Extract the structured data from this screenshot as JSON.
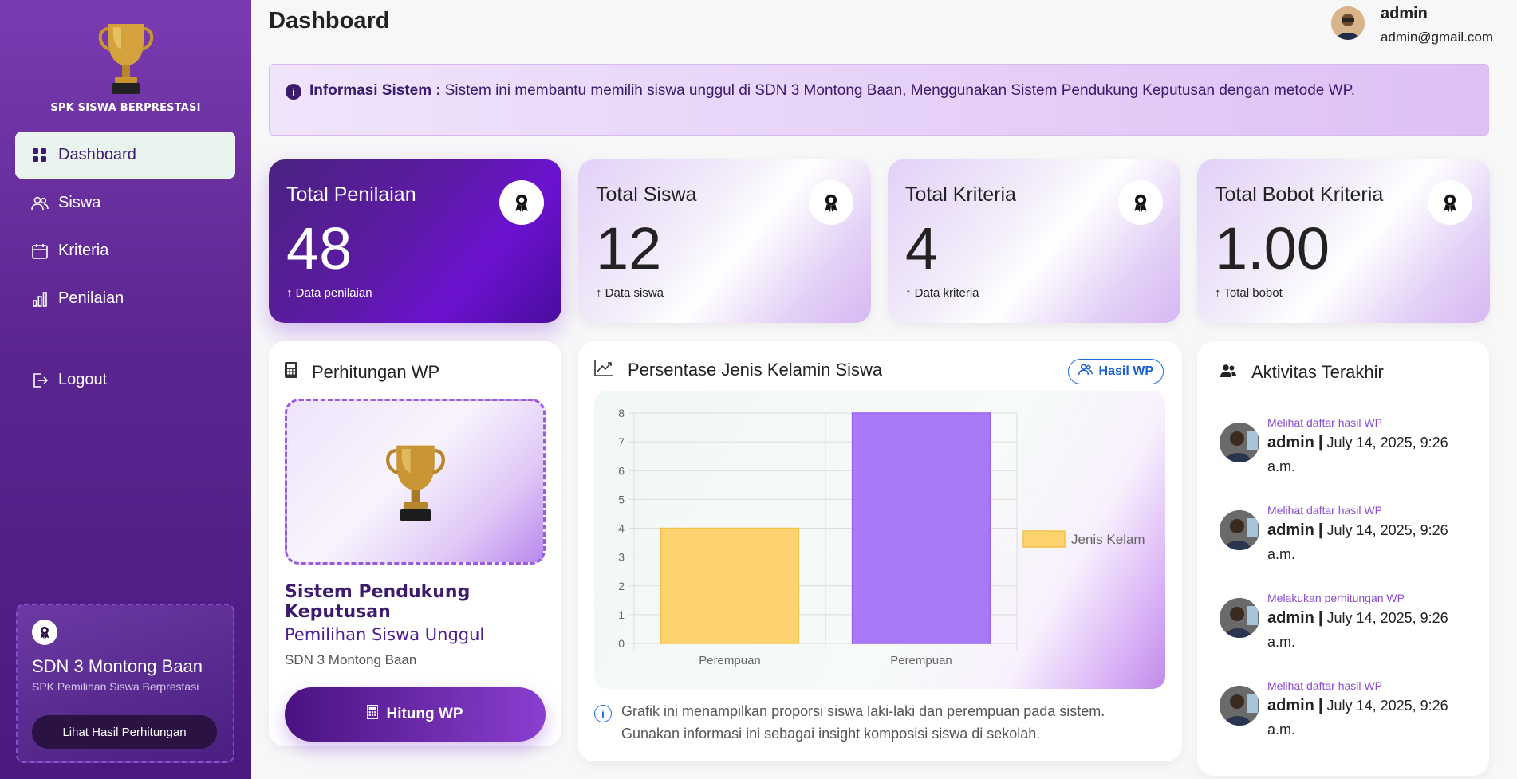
{
  "sidebar": {
    "brand": "SPK SISWA BERPRESTASI",
    "nav": [
      {
        "label": "Dashboard",
        "icon": "grid-icon",
        "active": true
      },
      {
        "label": "Siswa",
        "icon": "users-icon"
      },
      {
        "label": "Kriteria",
        "icon": "calendar-icon"
      },
      {
        "label": "Penilaian",
        "icon": "bar-chart-icon"
      }
    ],
    "logout": "Logout",
    "card": {
      "school_a": "SDN 3",
      "school_b": "Montong Baan",
      "subtitle": "SPK Pemilihan Siswa Berprestasi",
      "button": "Lihat Hasil Perhitungan"
    }
  },
  "header": {
    "title": "Dashboard",
    "user_name": "admin",
    "user_email": "admin@gmail.com"
  },
  "info": {
    "label": "Informasi Sistem :",
    "text": "Sistem ini membantu memilih siswa unggul di SDN 3 Montong Baan, Menggunakan Sistem Pendukung Keputusan dengan metode WP."
  },
  "stats": [
    {
      "label": "Total Penilaian",
      "value": "48",
      "note": "↑ Data penilaian"
    },
    {
      "label": "Total Siswa",
      "value": "12",
      "note": "↑ Data siswa"
    },
    {
      "label": "Total Kriteria",
      "value": "4",
      "note": "↑ Data kriteria"
    },
    {
      "label": "Total Bobot Kriteria",
      "value": "1.00",
      "note": "↑ Total bobot"
    }
  ],
  "wp": {
    "title": "Perhitungan WP",
    "heading1": "Sistem Pendukung Keputusan",
    "heading2": "Pemilihan Siswa Unggul",
    "school": "SDN 3 Montong Baan",
    "button": "Hitung WP"
  },
  "chart_card": {
    "title": "Persentase Jenis Kelamin Siswa",
    "button": "Hasil WP",
    "note": "Grafik ini menampilkan proporsi siswa laki-laki dan perempuan pada sistem. Gunakan informasi ini sebagai insight komposisi siswa di sekolah."
  },
  "chart_data": {
    "type": "bar",
    "categories": [
      "Perempuan",
      "Perempuan"
    ],
    "series": [
      {
        "name": "Jenis Kelam",
        "values": [
          4,
          8
        ]
      }
    ],
    "colors": [
      "#fcd36e",
      "#a97af7"
    ],
    "ylim": [
      0,
      8
    ],
    "yticks": [
      "0",
      "1",
      "2",
      "3",
      "4",
      "5",
      "6",
      "7",
      "8"
    ],
    "legend_position": "right",
    "grid": true
  },
  "activity": {
    "title": "Aktivitas Terakhir",
    "items": [
      {
        "action": "Melihat daftar hasil WP",
        "user": "admin",
        "sep": "|",
        "time": "July 14, 2025, 9:26 a.m."
      },
      {
        "action": "Melihat daftar hasil WP",
        "user": "admin",
        "sep": "|",
        "time": "July 14, 2025, 9:26 a.m."
      },
      {
        "action": "Melakukan perhitungan WP",
        "user": "admin",
        "sep": "|",
        "time": "July 14, 2025, 9:26 a.m."
      },
      {
        "action": "Melihat daftar hasil WP",
        "user": "admin",
        "sep": "|",
        "time": "July 14, 2025, 9:26 a.m."
      }
    ]
  }
}
